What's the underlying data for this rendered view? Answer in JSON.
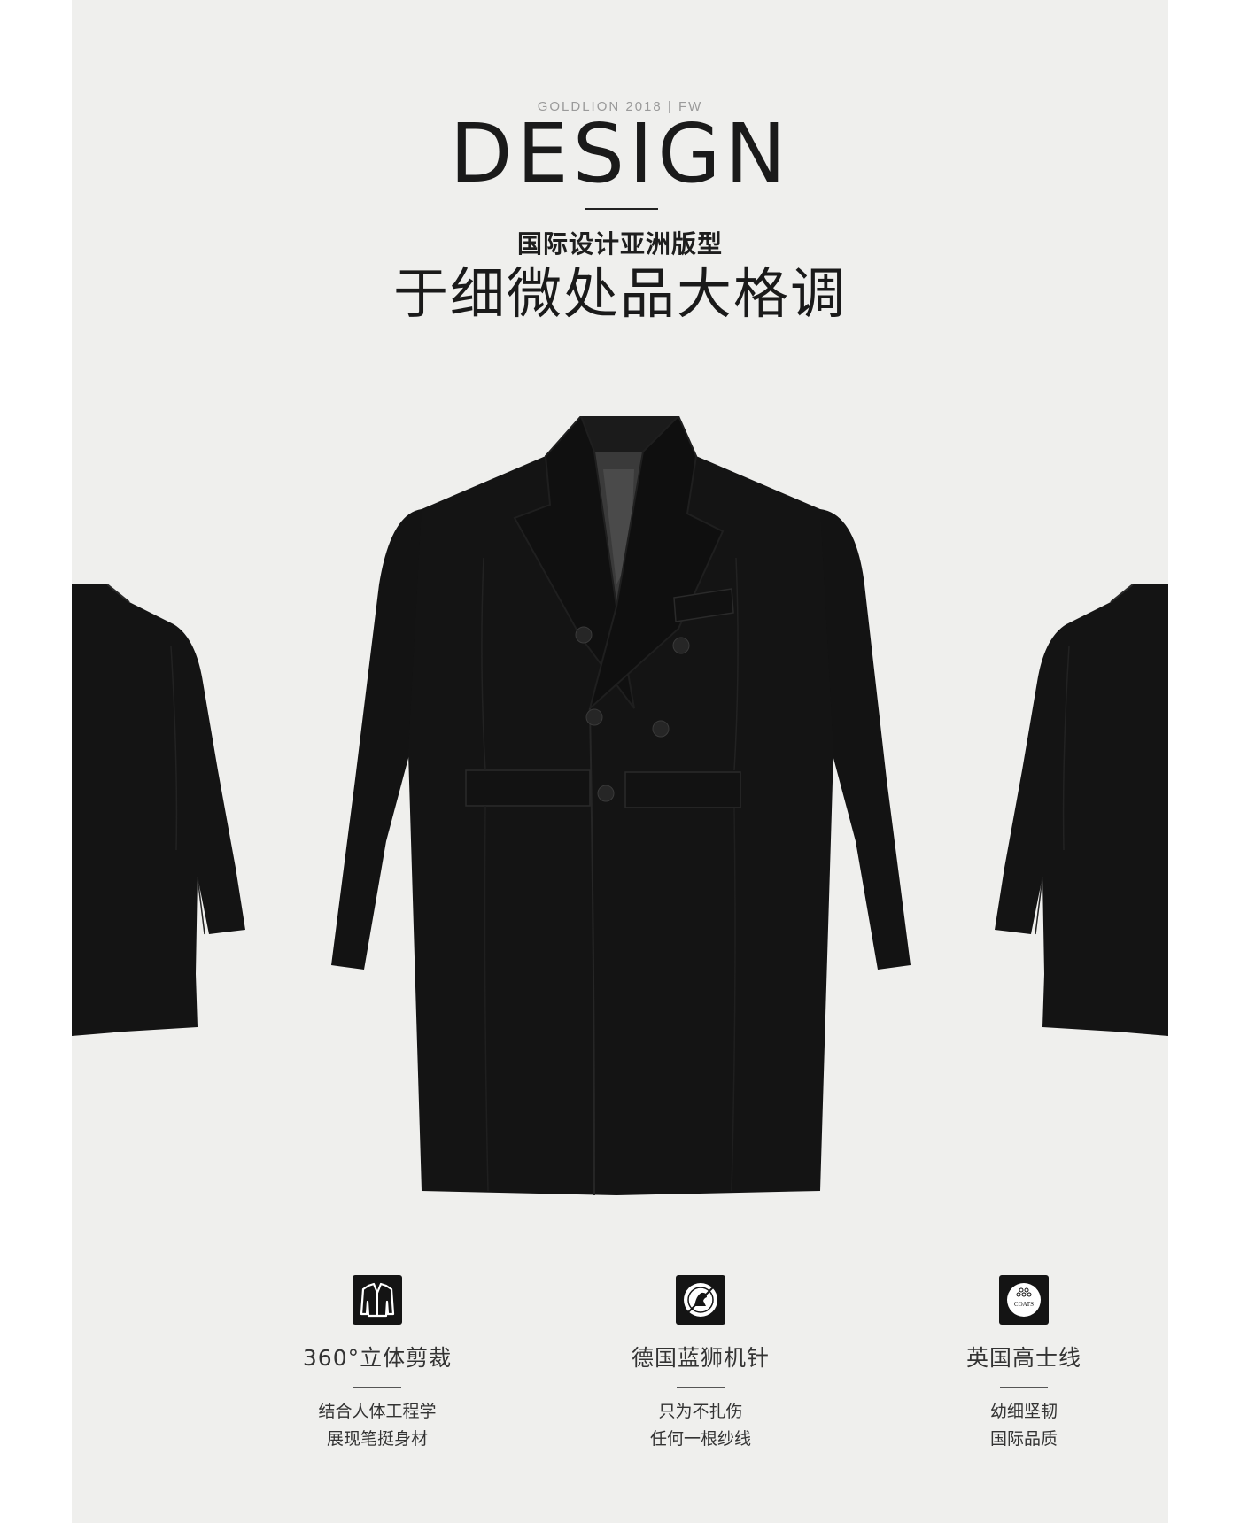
{
  "header": {
    "brand_line": "GOLDLION  2018 | FW",
    "title": "DESIGN",
    "subtitle": "国际设计亚洲版型",
    "headline": "于细微处品大格调"
  },
  "colors": {
    "panel_background": "#efefed",
    "coat": "#131313",
    "text": "#1a1a1a",
    "icon_box": "#141414"
  },
  "features": [
    {
      "icon": "suit-jacket-icon",
      "title": "360°立体剪裁",
      "lines": [
        "结合人体工程学",
        "展现笔挺身材"
      ]
    },
    {
      "icon": "lion-emblem-icon",
      "title": "德国蓝狮机针",
      "lines": [
        "只为不扎伤",
        "任何一根纱线"
      ]
    },
    {
      "icon": "coats-logo-icon",
      "title": "英国高士线",
      "lines": [
        "幼细坚韧",
        "国际品质"
      ]
    }
  ],
  "coats_logo_text": "COATS"
}
